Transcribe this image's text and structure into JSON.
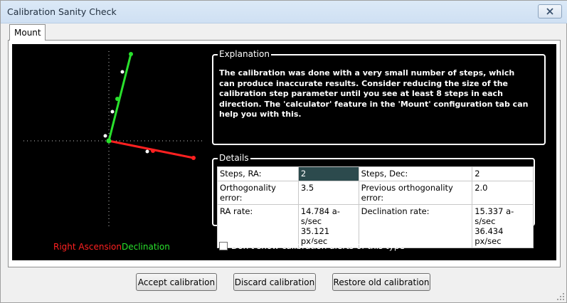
{
  "window": {
    "title": "Calibration Sanity Check"
  },
  "tabs": [
    {
      "label": "Mount"
    }
  ],
  "legend": {
    "ra_label": "Right Ascension",
    "dec_label": "Declination",
    "ra_color": "#ff2020",
    "dec_color": "#29e02c"
  },
  "explanation": {
    "title": "Explanation",
    "text": "The calibration was done with a very small number of steps, which can produce inaccurate results. Consider reducing the size of the calibration step parameter until you see at least 8 steps in each direction.  The 'calculator' feature in the 'Mount' configuration tab can help you with this."
  },
  "details": {
    "title": "Details",
    "rows": [
      [
        "Steps, RA:",
        "2",
        "Steps, Dec:",
        "2"
      ],
      [
        "Orthogonality error:",
        "3.5",
        "Previous orthogonality error:",
        "2.0"
      ],
      [
        "RA rate:",
        "14.784 a-s/sec\n35.121 px/sec",
        "Declination rate:",
        "15.337 a-s/sec\n36.434 px/sec"
      ]
    ]
  },
  "options": {
    "dont_show_label": "Don't show calibration alerts of this type",
    "dont_show_checked": false
  },
  "buttons": {
    "accept": "Accept calibration",
    "discard": "Discard calibration",
    "restore": "Restore old calibration"
  },
  "icons": {
    "close": "close-icon",
    "resize": "resize-grip-icon"
  }
}
